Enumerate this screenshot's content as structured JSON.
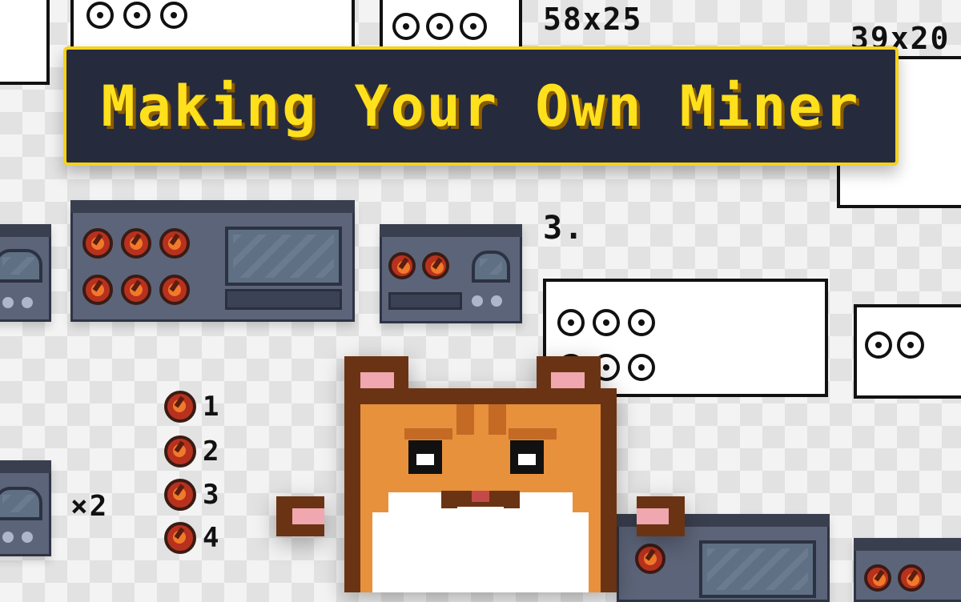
{
  "title": "Making Your Own Miner",
  "sketch_labels": {
    "size_a": "58x25",
    "size_b": "39x20",
    "step": "3.",
    "multiplier": "×2"
  },
  "legend": [
    {
      "num": "1"
    },
    {
      "num": "2"
    },
    {
      "num": "3"
    },
    {
      "num": "4"
    }
  ],
  "colors": {
    "banner_bg": "#262a3d",
    "banner_border": "#f5d21a",
    "title_text": "#ffe01c",
    "machine_body": "#5c6479",
    "knob": "#b8311f",
    "hamster_fur": "#e8913c",
    "hamster_dark": "#6a3414"
  },
  "mascot": "hamster"
}
